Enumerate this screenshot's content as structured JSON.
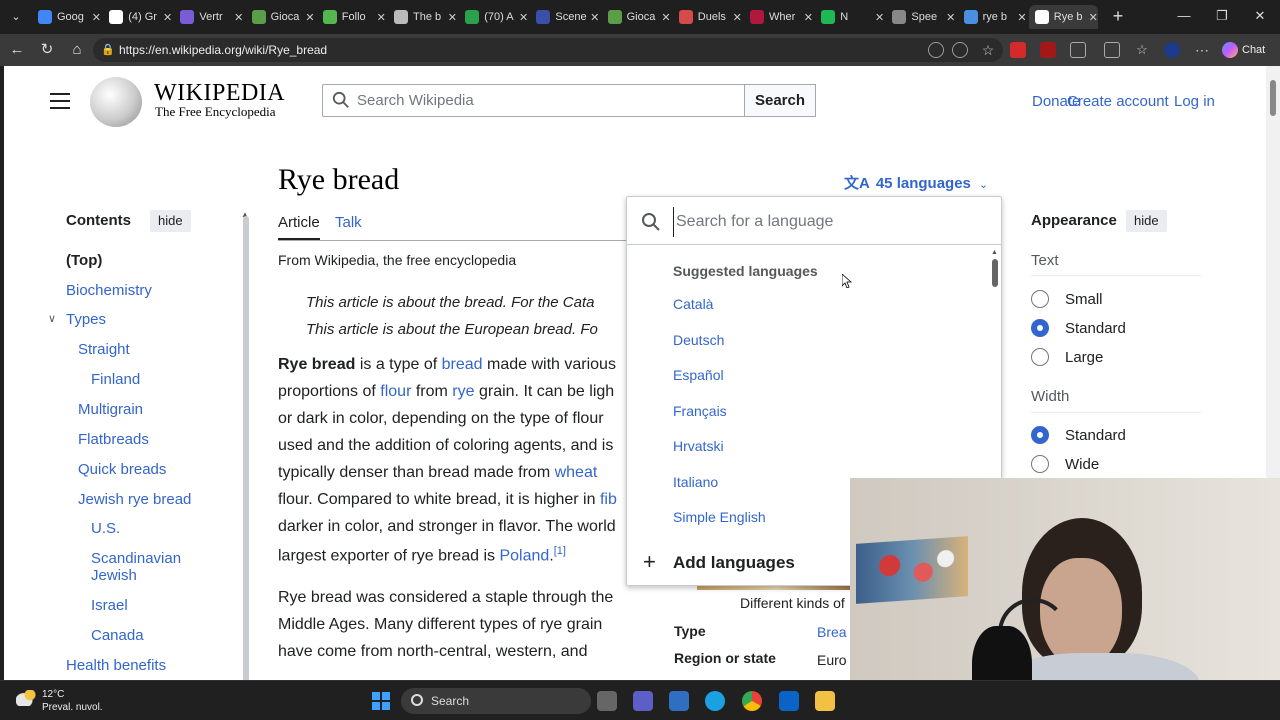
{
  "browser": {
    "tabs": [
      {
        "title": "Goog",
        "color": "#4285f4"
      },
      {
        "title": "(4) Gr",
        "color": "#ffffff"
      },
      {
        "title": "Vertr",
        "color": "#7a5cd6"
      },
      {
        "title": "Gioca",
        "color": "#5a9e4a"
      },
      {
        "title": "Follo",
        "color": "#53b94e"
      },
      {
        "title": "The b",
        "color": "#bbbbbb"
      },
      {
        "title": "(70) A",
        "color": "#2aa14c"
      },
      {
        "title": "Scene",
        "color": "#3a4fa8"
      },
      {
        "title": "Gioca",
        "color": "#5a9e4a"
      },
      {
        "title": "Duels",
        "color": "#d34b4b"
      },
      {
        "title": "Wher",
        "color": "#b0183e"
      },
      {
        "title": "N",
        "color": "#1db954"
      },
      {
        "title": "Spee",
        "color": "#888888"
      },
      {
        "title": "rye b",
        "color": "#4a90e2"
      },
      {
        "title": "Rye b",
        "color": "#ffffff"
      }
    ],
    "active_tab_index": 14,
    "url": "https://en.wikipedia.org/wiki/Rye_bread",
    "chat_label": "Chat"
  },
  "wiki": {
    "wordmark": "WIKIPEDIA",
    "tagline": "The Free Encyclopedia",
    "search_placeholder": "Search Wikipedia",
    "search_button": "Search",
    "user_links": {
      "donate": "Donate",
      "create_account": "Create account",
      "login": "Log in"
    },
    "title": "Rye bread",
    "languages": "45 languages",
    "tabs": {
      "article": "Article",
      "talk": "Talk"
    }
  },
  "toc": {
    "heading": "Contents",
    "hide": "hide",
    "items": [
      "(Top)",
      "Biochemistry",
      "Types",
      "Straight",
      "Finland",
      "Multigrain",
      "Flatbreads",
      "Quick breads",
      "Jewish rye bread",
      "U.S.",
      "Scandinavian",
      "Jewish",
      "Israel",
      "Canada",
      "Health benefits"
    ]
  },
  "article": {
    "from": "From Wikipedia, the free encyclopedia",
    "hatnote1": "This article is about the bread. For the Cata",
    "hatnote2": "This article is about the European bread. Fo",
    "lines": {
      "l1a": "Rye bread",
      "l1b": " is a type of ",
      "l1c": "bread",
      "l1d": " made with various",
      "l2a": "proportions of ",
      "l2b": "flour",
      "l2c": " from ",
      "l2d": "rye",
      "l2e": " grain. It can be ligh",
      "l3": "or dark in color, depending on the type of flour",
      "l4": "used and the addition of coloring agents, and is",
      "l5a": "typically denser than bread made from ",
      "l5b": "wheat",
      "l6a": "flour. Compared to white bread, it is higher in ",
      "l6b": "fib",
      "l7": "darker in color, and stronger in flavor. The world",
      "l8a": "largest exporter of rye bread is ",
      "l8b": "Poland",
      "l8c": ".",
      "l8d": "[1]",
      "p2l1": "Rye bread was considered a staple through the",
      "p2l2": "Middle Ages. Many different types of rye grain",
      "p2l3": "have come from north-central, western, and"
    }
  },
  "infobox": {
    "caption": "Different kinds of",
    "rows": [
      {
        "label": "Type",
        "value": "Brea"
      },
      {
        "label": "Region or state",
        "value": "Euro"
      }
    ]
  },
  "appearance": {
    "heading": "Appearance",
    "hide": "hide",
    "text_label": "Text",
    "text_options": [
      "Small",
      "Standard",
      "Large"
    ],
    "text_selected": "Standard",
    "width_label": "Width",
    "width_options": [
      "Standard",
      "Wide"
    ],
    "width_selected": "Standard"
  },
  "language_popup": {
    "search_placeholder": "Search for a language",
    "suggested_heading": "Suggested languages",
    "languages": [
      "Català",
      "Deutsch",
      "Español",
      "Français",
      "Hrvatski",
      "Italiano",
      "Simple English"
    ],
    "add_languages": "Add languages"
  },
  "taskbar": {
    "temperature": "12°C",
    "weather": "Preval. nuvol.",
    "search": "Search"
  },
  "colors": {
    "link": "#3366cc",
    "accent": "#3366cc",
    "text": "#202122"
  }
}
